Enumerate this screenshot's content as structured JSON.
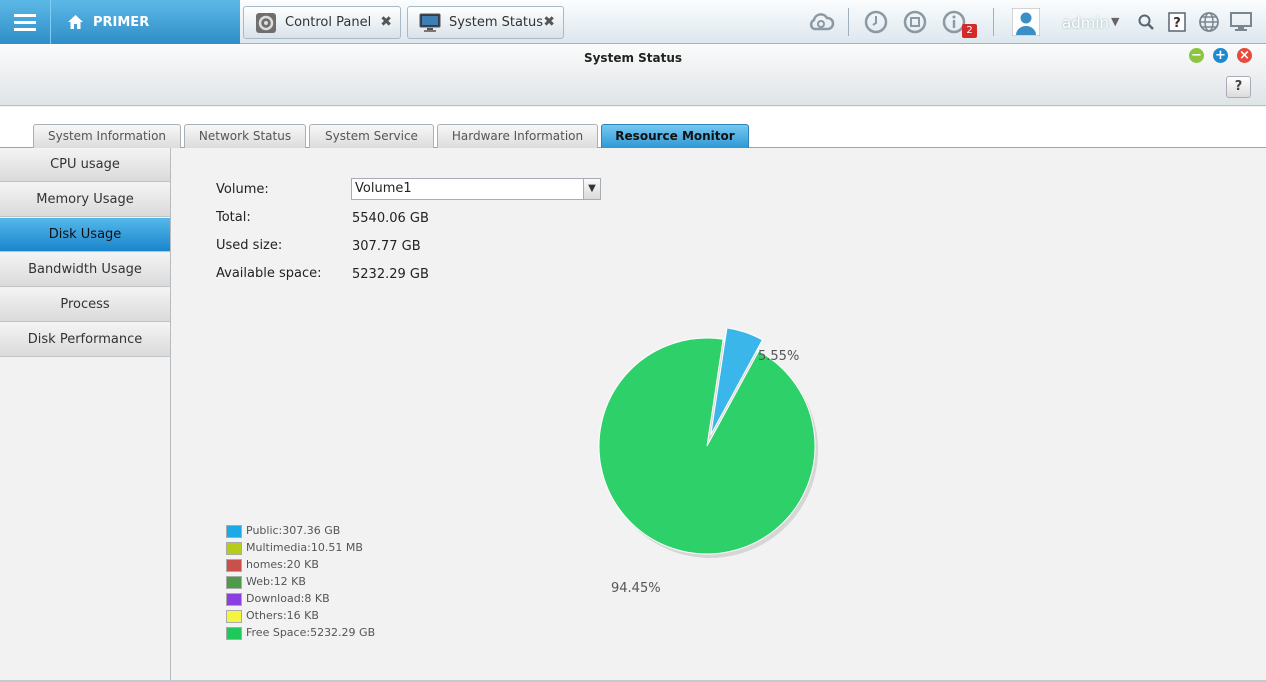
{
  "topbar": {
    "home_label": "PRIMER",
    "tabs": [
      {
        "label": "Control Panel",
        "close": "✖"
      },
      {
        "label": "System Status",
        "close": "✖"
      }
    ],
    "notification_count": "2",
    "user": "admin"
  },
  "window": {
    "title": "System Status",
    "help_label": "?"
  },
  "tabs": [
    {
      "label": "System Information"
    },
    {
      "label": "Network Status"
    },
    {
      "label": "System Service"
    },
    {
      "label": "Hardware Information"
    },
    {
      "label": "Resource Monitor",
      "active": true
    }
  ],
  "sidebar": {
    "items": [
      {
        "label": "CPU usage"
      },
      {
        "label": "Memory Usage"
      },
      {
        "label": "Disk Usage",
        "active": true
      },
      {
        "label": "Bandwidth Usage"
      },
      {
        "label": "Process"
      },
      {
        "label": "Disk Performance"
      }
    ]
  },
  "disk": {
    "volume_label": "Volume:",
    "volume_value": "Volume1",
    "total_label": "Total:",
    "total_value": "5540.06 GB",
    "used_label": "Used size:",
    "used_value": "307.77 GB",
    "available_label": "Available space:",
    "available_value": "5232.29 GB"
  },
  "legend": [
    {
      "text": "Public:307.36 GB",
      "color": "#1ba9e8"
    },
    {
      "text": "Multimedia:10.51 MB",
      "color": "#b6cc17"
    },
    {
      "text": "homes:20 KB",
      "color": "#c9504b"
    },
    {
      "text": "Web:12 KB",
      "color": "#4c9a4a"
    },
    {
      "text": "Download:8 KB",
      "color": "#8a3fe0"
    },
    {
      "text": "Others:16 KB",
      "color": "#f3f540"
    },
    {
      "text": "Free Space:5232.29 GB",
      "color": "#1ec95c"
    }
  ],
  "chart_data": {
    "type": "pie",
    "slices": [
      {
        "label": "Public",
        "value": 5.55,
        "color": "#3bb6ea",
        "exploded": true
      },
      {
        "label": "Free Space",
        "value": 94.45,
        "color": "#2ed06a"
      }
    ],
    "data_labels": [
      "5.55%",
      "94.45%"
    ]
  }
}
